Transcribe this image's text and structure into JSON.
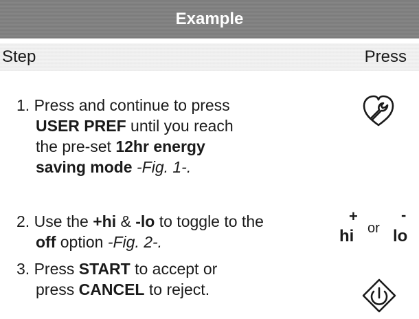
{
  "header": {
    "title": "Example"
  },
  "columns": {
    "step": "Step",
    "press": "Press"
  },
  "steps": [
    {
      "number": "1.",
      "line1": "Press and continue to press",
      "line2_bold": "USER PREF",
      "line2_rest": " until you reach",
      "line3_pre": "the pre-set ",
      "line3_bold": "12hr energy",
      "line4_bold": "saving mode",
      "line4_italic": " -Fig. 1-.",
      "icon": "wrench-icon"
    },
    {
      "number": "2.",
      "text1": " Use the ",
      "bold1": "+hi",
      "text2": " & ",
      "bold2": "-lo",
      "text3": " to toggle to the",
      "bold3": "off",
      "text4": " option ",
      "italic": "-Fig. 2-.",
      "buttons": {
        "plus": "+",
        "minus": "-",
        "hi": "hi",
        "or": "or",
        "lo": "lo"
      }
    },
    {
      "number": "3.",
      "text1": " Press ",
      "bold1": "START",
      "text2": " to accept or",
      "text3": "press ",
      "bold2": "CANCEL",
      "text4": " to reject.",
      "icon": "start-icon"
    }
  ]
}
